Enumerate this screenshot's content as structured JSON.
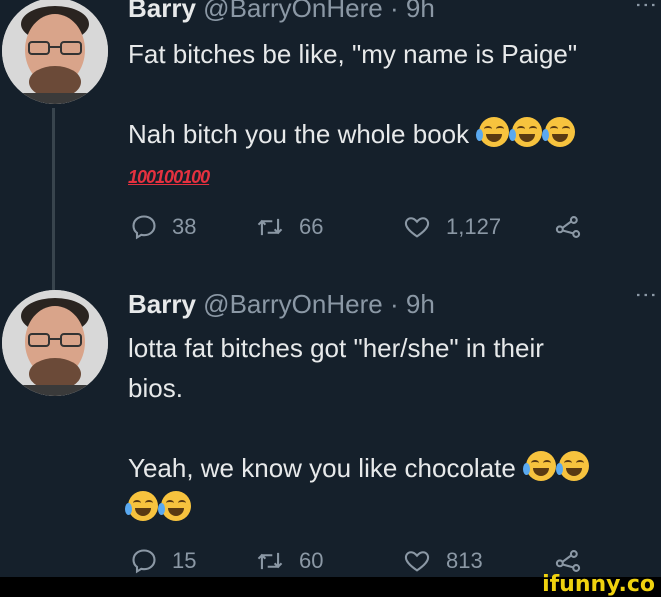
{
  "tweets": [
    {
      "name": "Barry",
      "handle": "@BarryOnHere",
      "separator": "·",
      "time": "9h",
      "lines": [
        "Fat bitches be like, \"my name is Paige\"",
        "Nah bitch you the whole book"
      ],
      "hundreds": [
        "100",
        "100",
        "100"
      ],
      "actions": {
        "replies": "38",
        "retweets": "66",
        "likes": "1,127"
      }
    },
    {
      "name": "Barry",
      "handle": "@BarryOnHere",
      "separator": "·",
      "time": "9h",
      "lines": [
        "lotta fat bitches got \"her/she\" in their",
        "bios.",
        "Yeah, we know you like chocolate"
      ],
      "actions": {
        "replies": "15",
        "retweets": "60",
        "likes": "813"
      }
    }
  ],
  "icons": {
    "reply": "speech-bubble-icon",
    "retweet": "retweet-icon",
    "like": "heart-icon",
    "share": "share-icon",
    "emoji": "laughing-crying-emoji",
    "more": "more-vertical-icon"
  },
  "colors": {
    "background": "#15202b",
    "text": "#e7e9ea",
    "muted": "#8b98a5",
    "hundred": "#e5313f",
    "watermark": "#f0d20f"
  },
  "watermark": "ifunny.co"
}
